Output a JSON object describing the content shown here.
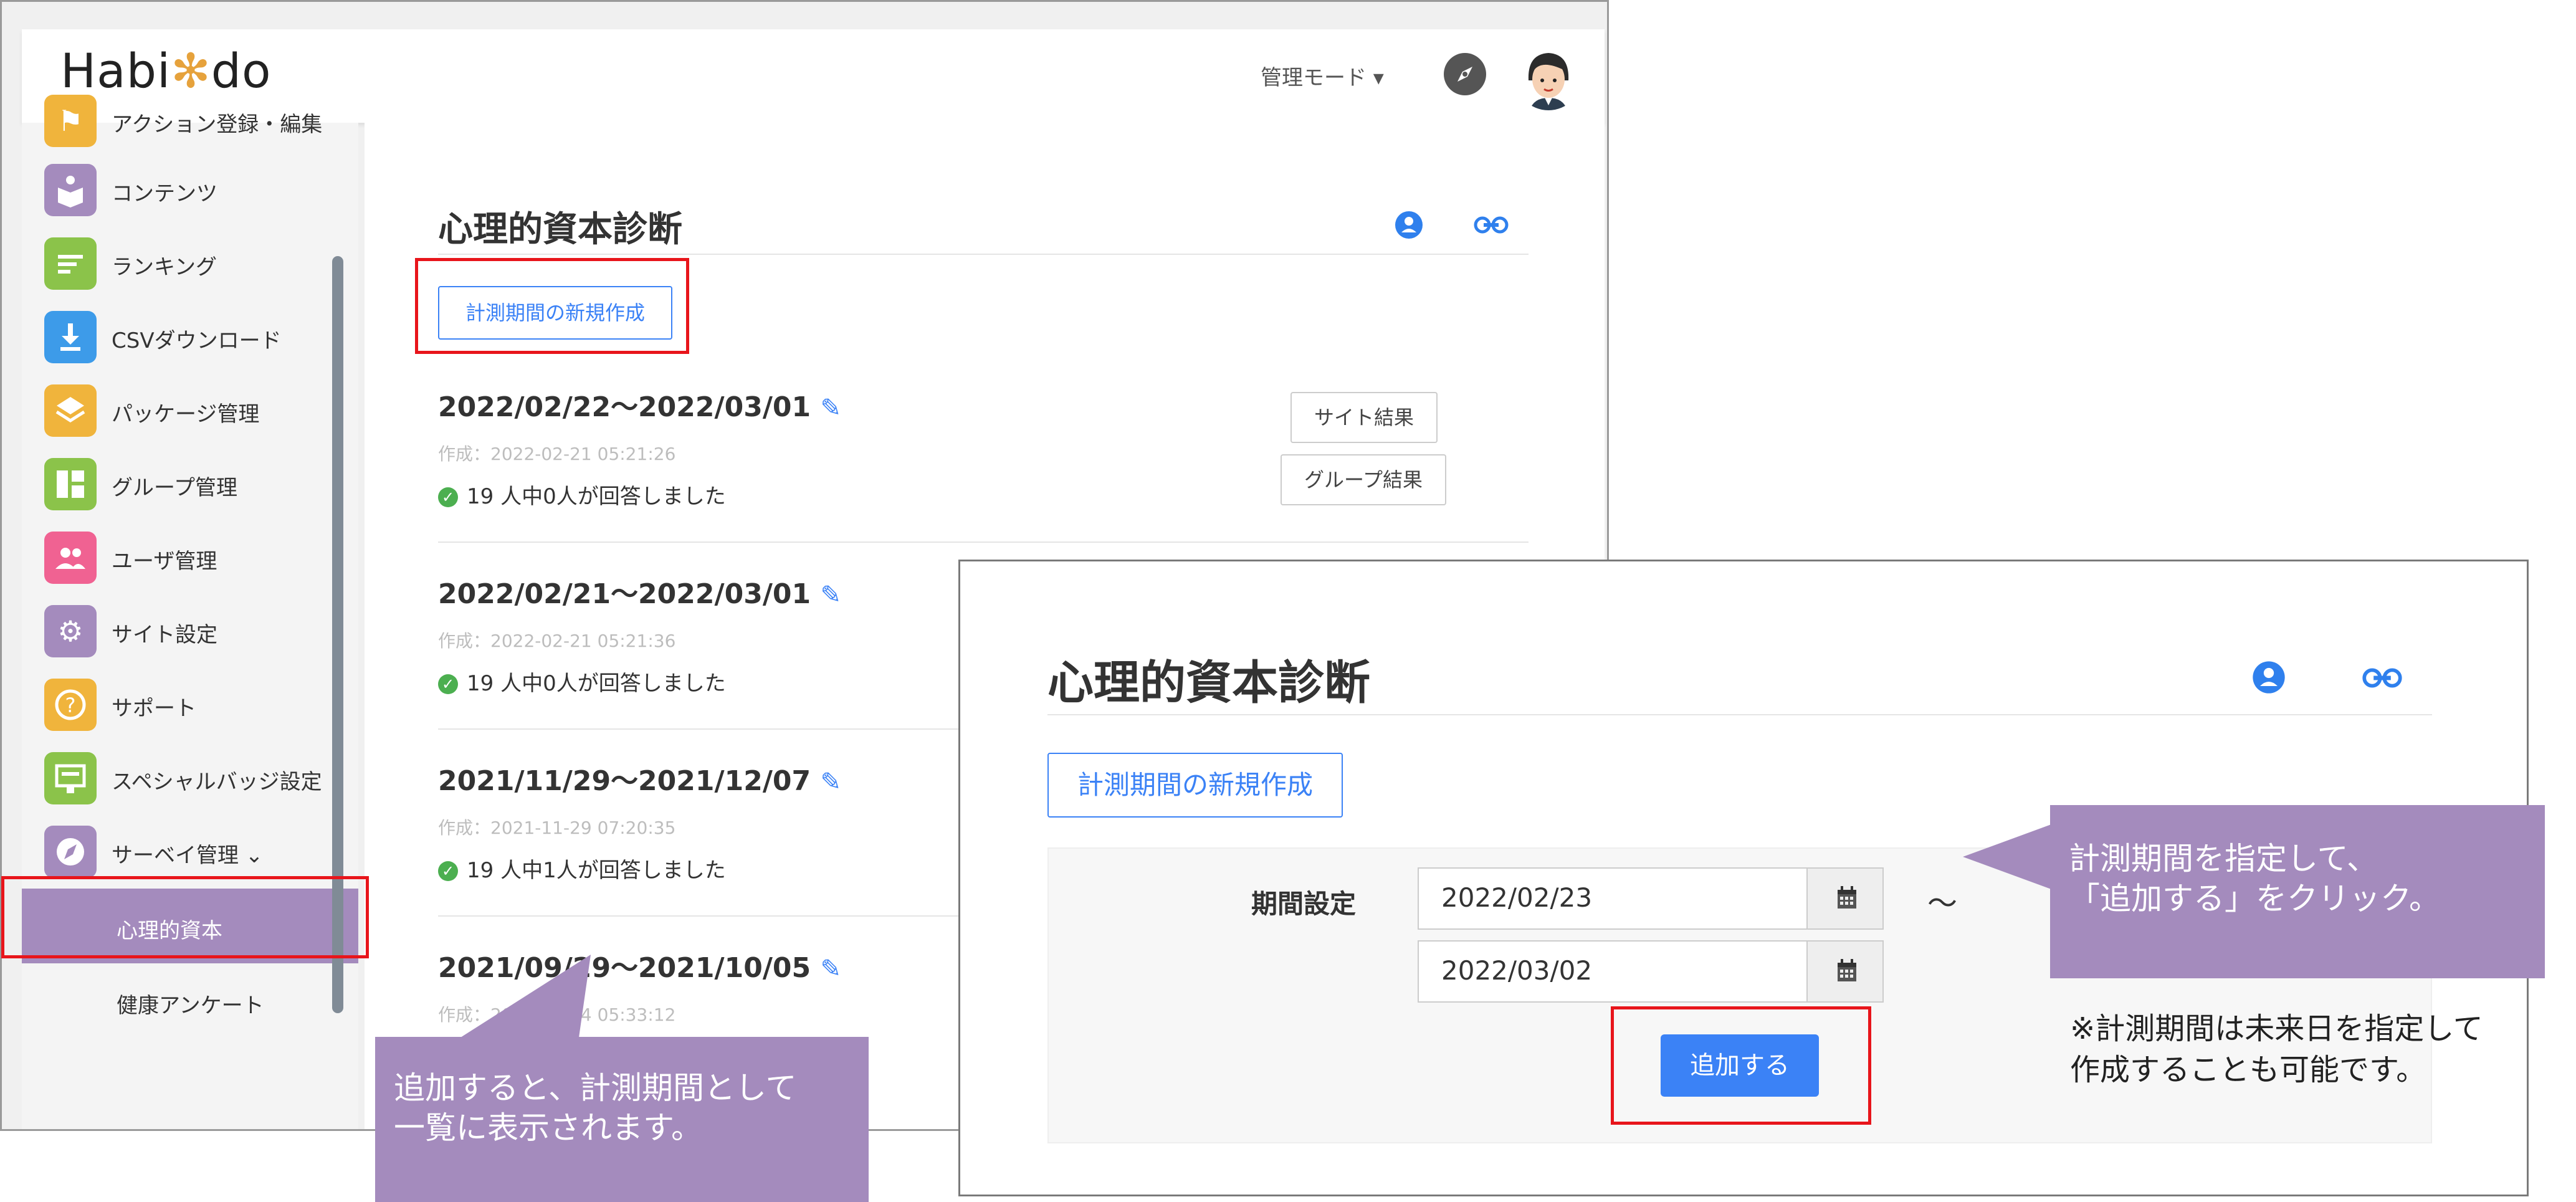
{
  "header": {
    "logo": "Habi",
    "logo_dot": "✻",
    "logo_end": "do",
    "mode_label": "管理モード ▾"
  },
  "sidebar": {
    "items": [
      {
        "label": "アクション登録・編集",
        "icon": "flag-icon",
        "color": "#f0b43c"
      },
      {
        "label": "コンテンツ",
        "icon": "book-icon",
        "color": "#a48bbd"
      },
      {
        "label": "ランキング",
        "icon": "ranking-icon",
        "color": "#8bc34a"
      },
      {
        "label": "CSVダウンロード",
        "icon": "download-icon",
        "color": "#3d9be9"
      },
      {
        "label": "パッケージ管理",
        "icon": "layers-icon",
        "color": "#f0b43c"
      },
      {
        "label": "グループ管理",
        "icon": "dashboard-icon",
        "color": "#8bc34a"
      },
      {
        "label": "ユーザ管理",
        "icon": "users-icon",
        "color": "#f06292"
      },
      {
        "label": "サイト設定",
        "icon": "gear-icon",
        "color": "#a48bbd"
      },
      {
        "label": "サポート",
        "icon": "question-icon",
        "color": "#f0b43c"
      },
      {
        "label": "スペシャルバッジ設定",
        "icon": "badge-icon",
        "color": "#8bc34a"
      },
      {
        "label": "サーベイ管理 ⌄",
        "icon": "compass-icon",
        "color": "#a48bbd"
      }
    ],
    "sub_items": [
      {
        "label": "心理的資本",
        "active": true
      },
      {
        "label": "健康アンケート",
        "active": false
      }
    ]
  },
  "main": {
    "title": "心理的資本診断",
    "new_period_button": "計測期間の新規作成",
    "site_result_button": "サイト結果",
    "group_result_button": "グループ結果",
    "periods": [
      {
        "range": "2022/02/22〜2022/03/01",
        "created": "作成：2022-02-21 05:21:26",
        "answered": "19 人中0人が回答しました"
      },
      {
        "range": "2022/02/21〜2022/03/01",
        "created": "作成：2022-02-21 05:21:36",
        "answered": "19 人中0人が回答しました"
      },
      {
        "range": "2021/11/29〜2021/12/07",
        "created": "作成：2021-11-29 07:20:35",
        "answered": "19 人中1人が回答しました"
      },
      {
        "range": "2021/09/29〜2021/10/05",
        "created": "作成：2021-09-24 05:33:12",
        "answered": ""
      }
    ]
  },
  "zoom": {
    "title": "心理的資本診断",
    "new_period_button": "計測期間の新規作成",
    "period_label": "期間設定",
    "start_date": "2022/02/23",
    "end_date": "2022/03/02",
    "tilde": "〜",
    "add_button": "追加する"
  },
  "callouts": {
    "left_line1": "追加すると、計測期間として",
    "left_line2": "一覧に表示されます。",
    "right_line1": "計測期間を指定して、",
    "right_line2": "「追加する」をクリック。",
    "note_line1": "※計測期間は未来日を指定して",
    "note_line2": "作成することも可能です。"
  },
  "colors": {
    "accent": "#3b82f6",
    "callout": "#a48bbd",
    "highlight": "#e8151b"
  }
}
